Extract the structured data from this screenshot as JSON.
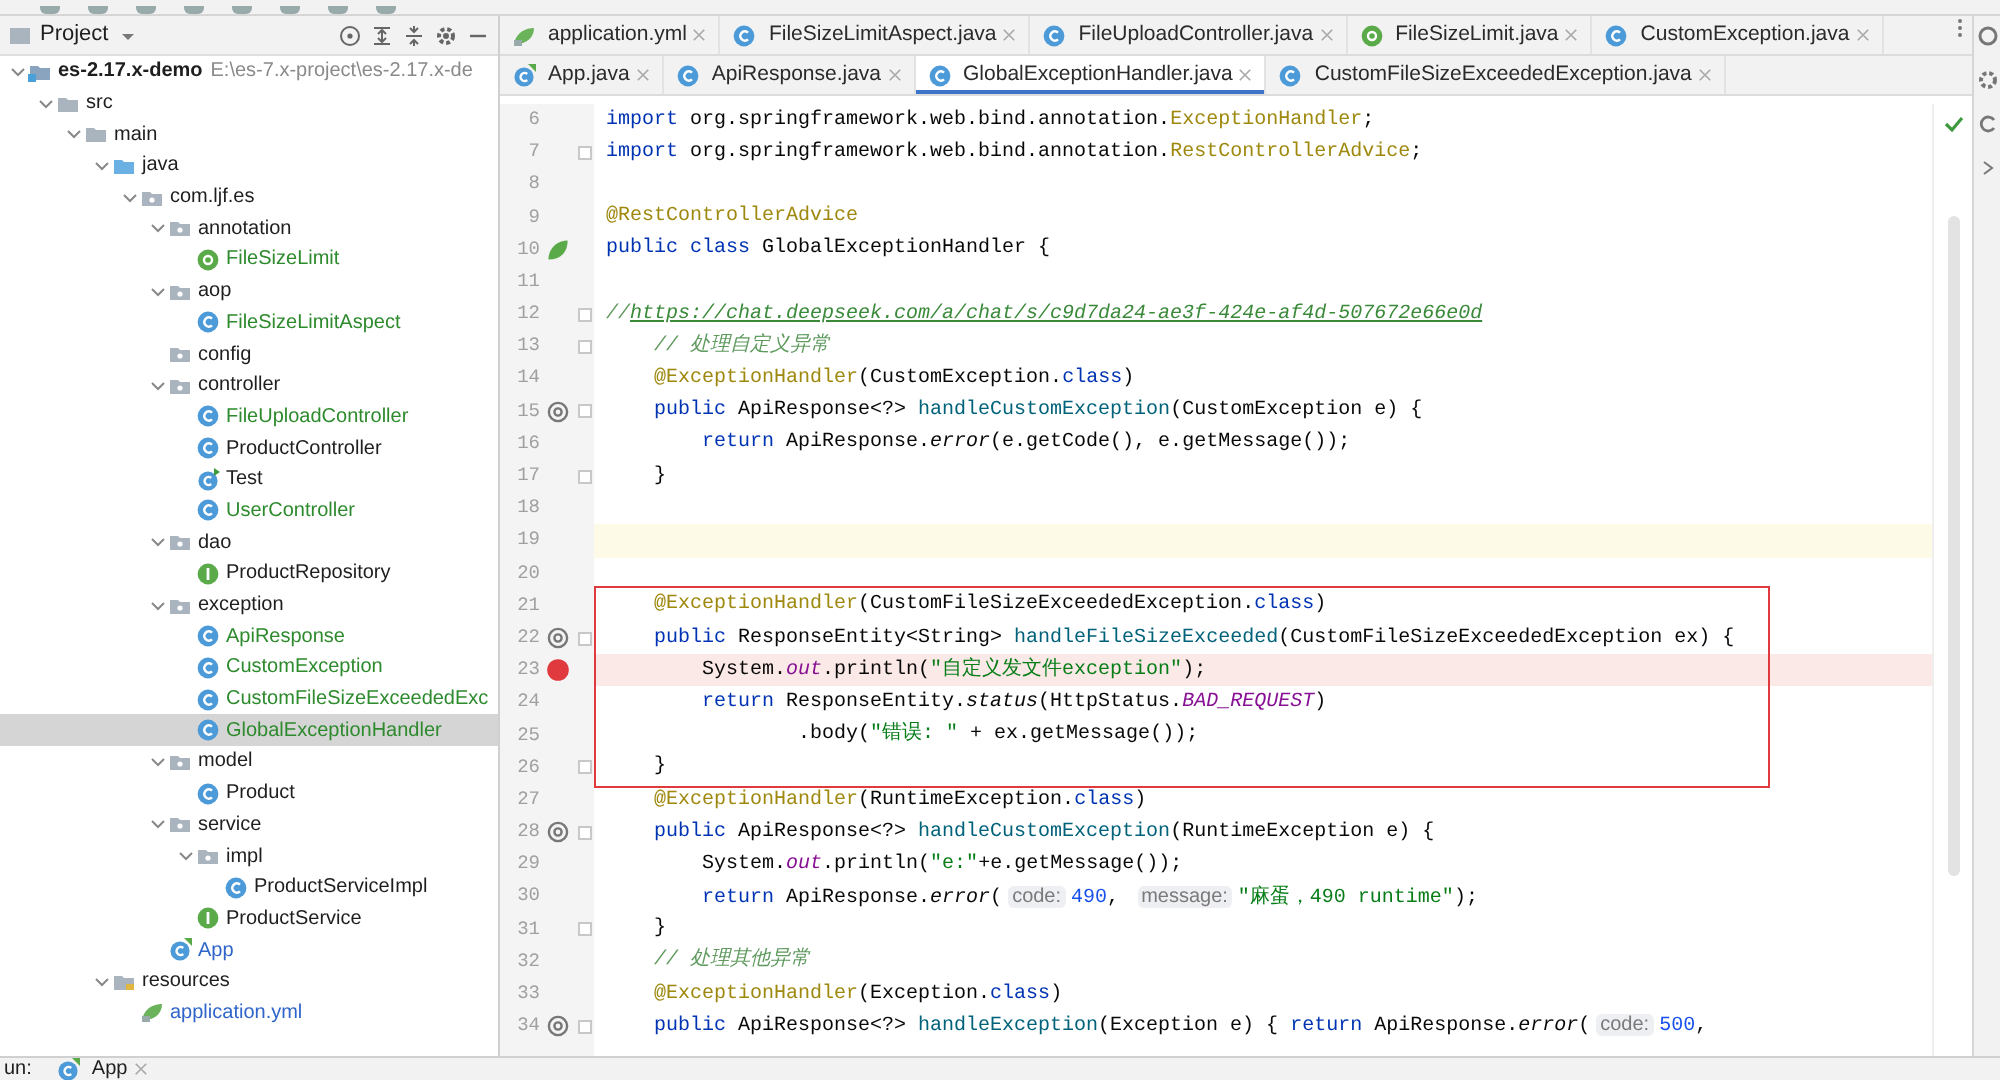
{
  "project_panel": {
    "title": "Project",
    "tree": [
      {
        "label": "es-2.17.x-demo",
        "path": "E:\\es-7.x-project\\es-2.17.x-de",
        "kind": "module",
        "selected": false,
        "expanded": true,
        "children": [
          {
            "label": "src",
            "kind": "folder",
            "selected": false,
            "expanded": true,
            "children": [
              {
                "label": "main",
                "kind": "folder",
                "selected": false,
                "expanded": true,
                "children": [
                  {
                    "label": "java",
                    "kind": "source",
                    "selected": false,
                    "expanded": true,
                    "children": [
                      {
                        "label": "com.ljf.es",
                        "kind": "package",
                        "selected": false,
                        "expanded": true,
                        "children": [
                          {
                            "label": "annotation",
                            "kind": "package",
                            "selected": false,
                            "expanded": true,
                            "children": [
                              {
                                "label": "FileSizeLimit",
                                "kind": "annotation",
                                "color": "#2d8a2d",
                                "selected": false
                              }
                            ]
                          },
                          {
                            "label": "aop",
                            "kind": "package",
                            "selected": false,
                            "expanded": true,
                            "children": [
                              {
                                "label": "FileSizeLimitAspect",
                                "kind": "class",
                                "color": "#2d8a2d",
                                "selected": false
                              }
                            ]
                          },
                          {
                            "label": "config",
                            "kind": "package",
                            "selected": false
                          },
                          {
                            "label": "controller",
                            "kind": "package",
                            "selected": false,
                            "expanded": true,
                            "children": [
                              {
                                "label": "FileUploadController",
                                "kind": "class",
                                "color": "#2d8a2d",
                                "selected": false
                              },
                              {
                                "label": "ProductController",
                                "kind": "class",
                                "selected": false
                              },
                              {
                                "label": "Test",
                                "kind": "runnable",
                                "selected": false
                              },
                              {
                                "label": "UserController",
                                "kind": "class",
                                "color": "#2d8a2d",
                                "selected": false
                              }
                            ]
                          },
                          {
                            "label": "dao",
                            "kind": "package",
                            "selected": false,
                            "expanded": true,
                            "children": [
                              {
                                "label": "ProductRepository",
                                "kind": "interface",
                                "selected": false
                              }
                            ]
                          },
                          {
                            "label": "exception",
                            "kind": "package",
                            "selected": false,
                            "expanded": true,
                            "children": [
                              {
                                "label": "ApiResponse",
                                "kind": "class",
                                "color": "#2d8a2d",
                                "selected": false
                              },
                              {
                                "label": "CustomException",
                                "kind": "class",
                                "color": "#2d8a2d",
                                "selected": false
                              },
                              {
                                "label": "CustomFileSizeExceededExc",
                                "kind": "class",
                                "color": "#2d8a2d",
                                "selected": false
                              },
                              {
                                "label": "GlobalExceptionHandler",
                                "kind": "class",
                                "color": "#2d8a2d",
                                "selected": true
                              }
                            ]
                          },
                          {
                            "label": "model",
                            "kind": "package",
                            "selected": false,
                            "expanded": true,
                            "children": [
                              {
                                "label": "Product",
                                "kind": "class",
                                "selected": false
                              }
                            ]
                          },
                          {
                            "label": "service",
                            "kind": "package",
                            "selected": false,
                            "expanded": true,
                            "children": [
                              {
                                "label": "impl",
                                "kind": "package",
                                "selected": false,
                                "expanded": true,
                                "children": [
                                  {
                                    "label": "ProductServiceImpl",
                                    "kind": "class",
                                    "selected": false
                                  }
                                ]
                              },
                              {
                                "label": "ProductService",
                                "kind": "interface",
                                "selected": false
                              }
                            ]
                          },
                          {
                            "label": "App",
                            "kind": "app",
                            "color": "#2f65ca",
                            "selected": false
                          }
                        ]
                      }
                    ]
                  },
                  {
                    "label": "resources",
                    "kind": "resources",
                    "selected": false,
                    "expanded": true,
                    "children": [
                      {
                        "label": "application.yml",
                        "kind": "yml",
                        "color": "#2f65ca",
                        "selected": false
                      }
                    ]
                  }
                ]
              }
            ]
          }
        ]
      }
    ]
  },
  "editor_tabs": [
    [
      {
        "label": "application.yml",
        "kind": "yml",
        "selected": false
      },
      {
        "label": "FileSizeLimitAspect.java",
        "kind": "class",
        "selected": false
      },
      {
        "label": "FileUploadController.java",
        "kind": "class",
        "selected": false
      },
      {
        "label": "FileSizeLimit.java",
        "kind": "annotation",
        "selected": false
      },
      {
        "label": "CustomException.java",
        "kind": "class",
        "selected": false
      }
    ],
    [
      {
        "label": "App.java",
        "kind": "app",
        "selected": false
      },
      {
        "label": "ApiResponse.java",
        "kind": "class",
        "selected": false
      },
      {
        "label": "GlobalExceptionHandler.java",
        "kind": "class",
        "selected": true
      },
      {
        "label": "CustomFileSizeExceededException.java",
        "kind": "class",
        "selected": false
      }
    ]
  ],
  "code_lines": [
    {
      "number": "6",
      "tokens": [
        {
          "kind": "keyword",
          "text": "import"
        },
        {
          "kind": "plain",
          "text": " org.springframework.web.bind.annotation."
        },
        {
          "kind": "annotation",
          "text": "ExceptionHandler"
        },
        {
          "kind": "plain",
          "text": ";"
        }
      ]
    },
    {
      "number": "7",
      "fold": true,
      "tokens": [
        {
          "kind": "keyword",
          "text": "import"
        },
        {
          "kind": "plain",
          "text": " org.springframework.web.bind.annotation."
        },
        {
          "kind": "annotation",
          "text": "RestControllerAdvice"
        },
        {
          "kind": "plain",
          "text": ";"
        }
      ]
    },
    {
      "number": "8"
    },
    {
      "number": "9",
      "tokens": [
        {
          "kind": "annotation",
          "text": "@RestControllerAdvice"
        }
      ]
    },
    {
      "number": "10",
      "spring_bean": true,
      "tokens": [
        {
          "kind": "keyword",
          "text": "public class"
        },
        {
          "kind": "plain",
          "text": " GlobalExceptionHandler {"
        }
      ]
    },
    {
      "number": "11"
    },
    {
      "number": "12",
      "fold": true,
      "tokens": [
        {
          "kind": "comment",
          "text": "//"
        },
        {
          "kind": "link",
          "text": "https://chat.deepseek.com/a/chat/s/c9d7da24-ae3f-424e-af4d-507672e66e0d"
        }
      ]
    },
    {
      "number": "13",
      "fold": true,
      "tokens": [
        {
          "kind": "comment",
          "text": "    // 处理自定义异常"
        }
      ]
    },
    {
      "number": "14",
      "tokens": [
        {
          "kind": "annotation",
          "text": "    @ExceptionHandler"
        },
        {
          "kind": "plain",
          "text": "(CustomException."
        },
        {
          "kind": "keyword",
          "text": "class"
        },
        {
          "kind": "plain",
          "text": ")"
        }
      ]
    },
    {
      "number": "15",
      "overrides": true,
      "fold": true,
      "tokens": [
        {
          "kind": "keyword",
          "text": "    public"
        },
        {
          "kind": "plain",
          "text": " ApiResponse<?> "
        },
        {
          "kind": "method",
          "text": "handleCustomException"
        },
        {
          "kind": "plain",
          "text": "(CustomException e) {"
        }
      ]
    },
    {
      "number": "16",
      "tokens": [
        {
          "kind": "keyword",
          "text": "        return"
        },
        {
          "kind": "plain",
          "text": " ApiResponse."
        },
        {
          "kind": "italic",
          "text": "error"
        },
        {
          "kind": "plain",
          "text": "(e.getCode(), e.getMessage());"
        }
      ]
    },
    {
      "number": "17",
      "fold": true,
      "tokens": [
        {
          "kind": "plain",
          "text": "    }"
        }
      ]
    },
    {
      "number": "18"
    },
    {
      "number": "19",
      "caret": true
    },
    {
      "number": "20"
    },
    {
      "number": "21",
      "boxed": true,
      "tokens": [
        {
          "kind": "annotation",
          "text": "    @ExceptionHandler"
        },
        {
          "kind": "plain",
          "text": "(CustomFileSizeExceededException."
        },
        {
          "kind": "keyword",
          "text": "class"
        },
        {
          "kind": "plain",
          "text": ")"
        }
      ]
    },
    {
      "number": "22",
      "boxed": true,
      "overrides": true,
      "fold": true,
      "tokens": [
        {
          "kind": "keyword",
          "text": "    public"
        },
        {
          "kind": "plain",
          "text": " ResponseEntity<String> "
        },
        {
          "kind": "method",
          "text": "handleFileSizeExceeded"
        },
        {
          "kind": "plain",
          "text": "(CustomFileSizeExceededException ex) {"
        }
      ]
    },
    {
      "number": "23",
      "boxed": true,
      "breakpoint": true,
      "tokens": [
        {
          "kind": "plain",
          "text": "        System."
        },
        {
          "kind": "field",
          "text": "out"
        },
        {
          "kind": "plain",
          "text": ".println("
        },
        {
          "kind": "string",
          "text": "\"自定义发文件exception\""
        },
        {
          "kind": "plain",
          "text": ");"
        }
      ]
    },
    {
      "number": "24",
      "boxed": true,
      "tokens": [
        {
          "kind": "keyword",
          "text": "        return"
        },
        {
          "kind": "plain",
          "text": " ResponseEntity."
        },
        {
          "kind": "italic",
          "text": "status"
        },
        {
          "kind": "plain",
          "text": "(HttpStatus."
        },
        {
          "kind": "field",
          "text": "BAD_REQUEST"
        },
        {
          "kind": "plain",
          "text": ")"
        }
      ]
    },
    {
      "number": "25",
      "boxed": true,
      "tokens": [
        {
          "kind": "plain",
          "text": "                .body("
        },
        {
          "kind": "string",
          "text": "\"错误: \""
        },
        {
          "kind": "plain",
          "text": " + ex.getMessage());"
        }
      ]
    },
    {
      "number": "26",
      "boxed": true,
      "fold": true,
      "tokens": [
        {
          "kind": "plain",
          "text": "    }"
        }
      ]
    },
    {
      "number": "27",
      "tokens": [
        {
          "kind": "annotation",
          "text": "    @ExceptionHandler"
        },
        {
          "kind": "plain",
          "text": "(RuntimeException."
        },
        {
          "kind": "keyword",
          "text": "class"
        },
        {
          "kind": "plain",
          "text": ")"
        }
      ]
    },
    {
      "number": "28",
      "overrides": true,
      "fold": true,
      "tokens": [
        {
          "kind": "keyword",
          "text": "    public"
        },
        {
          "kind": "plain",
          "text": " ApiResponse<?> "
        },
        {
          "kind": "method",
          "text": "handleCustomException"
        },
        {
          "kind": "plain",
          "text": "(RuntimeException e) {"
        }
      ]
    },
    {
      "number": "29",
      "tokens": [
        {
          "kind": "plain",
          "text": "        System."
        },
        {
          "kind": "field",
          "text": "out"
        },
        {
          "kind": "plain",
          "text": ".println("
        },
        {
          "kind": "string",
          "text": "\"e:\""
        },
        {
          "kind": "plain",
          "text": "+e.getMessage());"
        }
      ]
    },
    {
      "number": "30",
      "tokens": [
        {
          "kind": "keyword",
          "text": "        return"
        },
        {
          "kind": "plain",
          "text": " ApiResponse."
        },
        {
          "kind": "italic",
          "text": "error"
        },
        {
          "kind": "plain",
          "text": "("
        },
        {
          "kind": "hint",
          "text": "code:"
        },
        {
          "kind": "number",
          "text": "490"
        },
        {
          "kind": "plain",
          "text": ", "
        },
        {
          "kind": "hint",
          "text": "message:"
        },
        {
          "kind": "string",
          "text": "\"麻蛋，490 runtime\""
        },
        {
          "kind": "plain",
          "text": ");"
        }
      ]
    },
    {
      "number": "31",
      "fold": true,
      "tokens": [
        {
          "kind": "plain",
          "text": "    }"
        }
      ]
    },
    {
      "number": "32",
      "tokens": [
        {
          "kind": "comment",
          "text": "    // 处理其他异常"
        }
      ]
    },
    {
      "number": "33",
      "tokens": [
        {
          "kind": "annotation",
          "text": "    @ExceptionHandler"
        },
        {
          "kind": "plain",
          "text": "(Exception."
        },
        {
          "kind": "keyword",
          "text": "class"
        },
        {
          "kind": "plain",
          "text": ")"
        }
      ]
    },
    {
      "number": "34",
      "overrides": true,
      "fold": true,
      "tokens": [
        {
          "kind": "keyword",
          "text": "    public"
        },
        {
          "kind": "plain",
          "text": " ApiResponse<?> "
        },
        {
          "kind": "method",
          "text": "handleException"
        },
        {
          "kind": "plain",
          "text": "(Exception e) { "
        },
        {
          "kind": "keyword",
          "text": "return"
        },
        {
          "kind": "plain",
          "text": " ApiResponse."
        },
        {
          "kind": "italic",
          "text": "error"
        },
        {
          "kind": "plain",
          "text": "("
        },
        {
          "kind": "hint",
          "text": "code:"
        },
        {
          "kind": "number",
          "text": "500"
        },
        {
          "kind": "plain",
          "text": ","
        }
      ]
    }
  ],
  "run_bar": {
    "label": "un:",
    "tab": "App"
  }
}
